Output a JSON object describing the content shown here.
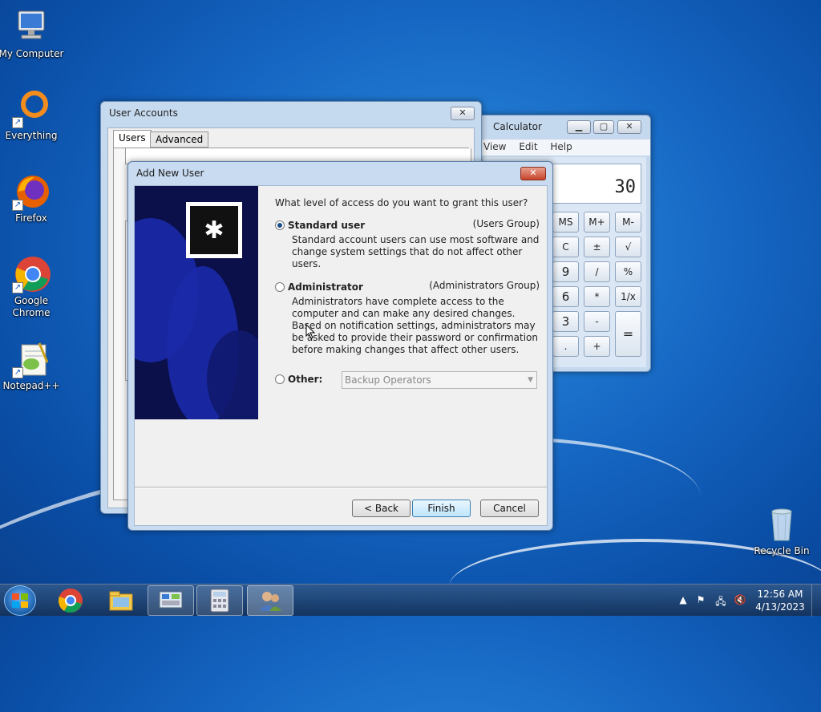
{
  "desktop": {
    "icons": [
      {
        "label": "My Computer",
        "icon": "computer-icon"
      },
      {
        "label": "Everything",
        "icon": "everything-icon"
      },
      {
        "label": "Firefox",
        "icon": "firefox-icon"
      },
      {
        "label": "Google Chrome",
        "icon": "chrome-icon"
      },
      {
        "label": "Notepad++",
        "icon": "notepadpp-icon"
      },
      {
        "label": "Recycle Bin",
        "icon": "recycle-bin-icon"
      }
    ]
  },
  "calculator": {
    "title": "Calculator",
    "menu": [
      "View",
      "Edit",
      "Help"
    ],
    "display": "30",
    "keys": {
      "ms": "MS",
      "mplus": "M+",
      "mminus": "M-",
      "c": "C",
      "plusminus": "±",
      "sqrt": "√",
      "nine": "9",
      "divide": "/",
      "percent": "%",
      "six": "6",
      "multiply": "*",
      "reciprocal": "1/x",
      "three": "3",
      "minus": "-",
      "equals": "=",
      "dot": ".",
      "plus": "+"
    }
  },
  "user_accounts": {
    "title": "User Accounts",
    "tabs": [
      "Users",
      "Advanced"
    ]
  },
  "add_new_user": {
    "title": "Add New User",
    "question": "What level of access do you want to grant this user?",
    "options": {
      "standard": {
        "name": "Standard user",
        "group": "(Users Group)",
        "description": "Standard account users can use most software and change system settings that do not affect other users.",
        "selected": true
      },
      "administrator": {
        "name": "Administrator",
        "group": "(Administrators Group)",
        "description": "Administrators have complete access to the computer and can make any desired changes. Based on notification settings, administrators may be asked to provide their password or confirmation before making changes that affect other users.",
        "selected": false
      },
      "other": {
        "name": "Other:",
        "selected": false,
        "select_value": "Backup Operators"
      }
    },
    "buttons": {
      "back": "< Back",
      "finish": "Finish",
      "cancel": "Cancel"
    }
  },
  "taskbar": {
    "clock_time": "12:56 AM",
    "clock_date": "4/13/2023"
  }
}
